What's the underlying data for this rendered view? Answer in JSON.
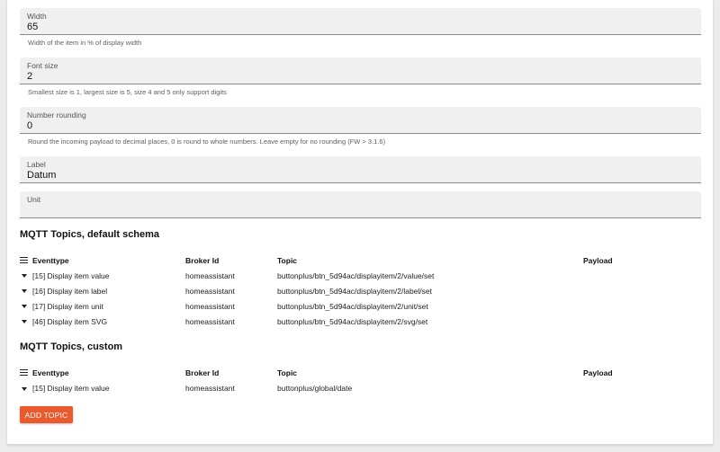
{
  "fields": [
    {
      "label": "Width",
      "value": "65",
      "helper": "Width of the item in % of display width"
    },
    {
      "label": "Font size",
      "value": "2",
      "helper": "Smallest size is 1, largest size is 5, size 4 and 5 only support digits"
    },
    {
      "label": "Number rounding",
      "value": "0",
      "helper": "Round the incoming payload to decimal places, 0 is round to whole numbers. Leave empty for no rounding (FW > 3.1.6)"
    },
    {
      "label": "Label",
      "value": "Datum",
      "helper": ""
    },
    {
      "label": "Unit",
      "value": "",
      "helper": ""
    }
  ],
  "default_topics": {
    "title": "MQTT Topics, default schema",
    "columns": [
      "Eventtype",
      "Broker Id",
      "Topic",
      "Payload"
    ],
    "rows": [
      {
        "eventtype": "[15] Display item value",
        "broker": "homeassistant",
        "topic": "buttonplus/btn_5d94ac/displayitem/2/value/set",
        "payload": ""
      },
      {
        "eventtype": "[16] Display item label",
        "broker": "homeassistant",
        "topic": "buttonplus/btn_5d94ac/displayitem/2/label/set",
        "payload": ""
      },
      {
        "eventtype": "[17] Display item unit",
        "broker": "homeassistant",
        "topic": "buttonplus/btn_5d94ac/displayitem/2/unit/set",
        "payload": ""
      },
      {
        "eventtype": "[46] Display item SVG",
        "broker": "homeassistant",
        "topic": "buttonplus/btn_5d94ac/displayitem/2/svg/set",
        "payload": ""
      }
    ]
  },
  "custom_topics": {
    "title": "MQTT Topics, custom",
    "columns": [
      "Eventtype",
      "Broker Id",
      "Topic",
      "Payload"
    ],
    "rows": [
      {
        "eventtype": "[15] Display item value",
        "broker": "homeassistant",
        "topic": "buttonplus/global/date",
        "payload": ""
      }
    ]
  },
  "add_topic_label": "ADD TOPIC",
  "colors": {
    "accent": "#ea5a2c",
    "field_bg": "#f0f0f0"
  },
  "icons": {
    "column_menu": "menu-icon",
    "row_expand": "caret-down-icon"
  }
}
